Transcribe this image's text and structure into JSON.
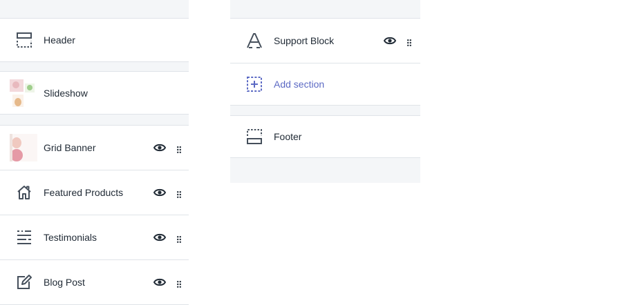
{
  "sections_left": [
    {
      "label": "Header",
      "icon": "header-icon",
      "visibility": false
    },
    {
      "label": "Slideshow",
      "icon": "slideshow-thumbnail",
      "visibility": false
    },
    {
      "label": "Grid Banner",
      "icon": "grid-banner-thumbnail",
      "visibility": true
    },
    {
      "label": "Featured Products",
      "icon": "house-icon",
      "visibility": true
    },
    {
      "label": "Testimonials",
      "icon": "testimonials-icon",
      "visibility": true
    },
    {
      "label": "Blog Post",
      "icon": "edit-icon",
      "visibility": true
    }
  ],
  "sections_right": [
    {
      "label": "Support Block",
      "icon": "typography-icon",
      "visibility": true
    },
    {
      "label": "Add section",
      "icon": "add-section-icon",
      "visibility": false
    },
    {
      "label": "Footer",
      "icon": "footer-icon",
      "visibility": false
    }
  ],
  "colors": {
    "text": "#212b36",
    "link": "#5c6ac4",
    "icon": "#454f5b",
    "separator_bg": "#f4f6f8",
    "border": "#dfe3e8"
  }
}
